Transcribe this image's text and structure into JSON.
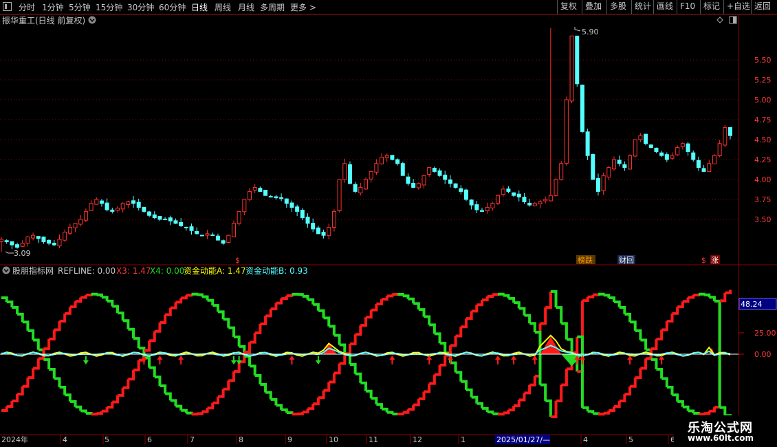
{
  "toolbar": {
    "periods": [
      "分时",
      "1分钟",
      "5分钟",
      "15分钟",
      "30分钟",
      "60分钟",
      "日线",
      "周线",
      "月线",
      "多周期",
      "更多 >"
    ],
    "active_period": "日线",
    "actions": [
      "复权",
      "叠加",
      "多股",
      "统计",
      "画线",
      "F10",
      "标记",
      "+自选",
      "返回"
    ]
  },
  "price_panel": {
    "title": "振华重工(日线 前复权)",
    "high_label": "5.90",
    "low_label": "3.09",
    "y_ticks": [
      "5.50",
      "5.25",
      "5.00",
      "4.75",
      "4.50",
      "4.25",
      "4.00",
      "3.75",
      "3.50"
    ],
    "markers": [
      {
        "text": "$",
        "color": "#ff3333"
      },
      {
        "text": "榜跌",
        "color": "#ff8800"
      },
      {
        "text": "财回",
        "color": "#ffffff"
      },
      {
        "text": "$",
        "color": "#ff3333"
      },
      {
        "text": "涨",
        "color": "#ffffff"
      }
    ]
  },
  "indicator_panel": {
    "name": "股朋指标网",
    "refline_label": "REFLINE: 0.00",
    "x3_label": "X3: 1.47",
    "x4_label": "X4: 0.00",
    "zjA_label": "资金动能A: 1.47",
    "zjB_label": "资金动能B: 0.93",
    "y_ticks": [
      "48.24",
      "25.00",
      "0.00"
    ],
    "highlight_value": "48.24"
  },
  "x_axis": {
    "labels": [
      "2024年",
      "4",
      "5",
      "6",
      "7",
      "8",
      "9",
      "10",
      "11",
      "12",
      "1",
      "2025/01/27/—",
      "4",
      "5",
      "6"
    ]
  },
  "watermark": {
    "title": "乐淘公式网",
    "url": "www.60lt.com"
  },
  "colors": {
    "up": "#ff3232",
    "down": "#54ffff",
    "green": "#22dd22",
    "red": "#ff1a1a",
    "yellow": "#ffff00",
    "grid": "#8b0000",
    "axis": "#c80000"
  },
  "chart_data": {
    "type": "candlestick",
    "price_range": [
      3.09,
      5.9
    ],
    "closes": [
      3.25,
      3.22,
      3.18,
      3.15,
      3.2,
      3.28,
      3.3,
      3.26,
      3.22,
      3.2,
      3.18,
      3.25,
      3.34,
      3.4,
      3.45,
      3.5,
      3.6,
      3.7,
      3.75,
      3.7,
      3.62,
      3.6,
      3.64,
      3.7,
      3.72,
      3.7,
      3.65,
      3.6,
      3.55,
      3.52,
      3.5,
      3.5,
      3.48,
      3.45,
      3.42,
      3.4,
      3.36,
      3.32,
      3.3,
      3.32,
      3.3,
      3.24,
      3.2,
      3.3,
      3.45,
      3.6,
      3.75,
      3.85,
      3.9,
      3.85,
      3.8,
      3.78,
      3.77,
      3.76,
      3.7,
      3.65,
      3.6,
      3.52,
      3.45,
      3.38,
      3.32,
      3.3,
      3.4,
      3.6,
      4.0,
      4.2,
      3.95,
      3.85,
      3.9,
      4.0,
      4.1,
      4.2,
      4.28,
      4.3,
      4.25,
      4.2,
      4.05,
      3.95,
      3.9,
      3.95,
      4.05,
      4.15,
      4.1,
      4.05,
      4.0,
      3.95,
      3.9,
      3.85,
      3.75,
      3.68,
      3.62,
      3.6,
      3.65,
      3.7,
      3.8,
      3.88,
      3.85,
      3.8,
      3.78,
      3.72,
      3.68,
      3.7,
      3.72,
      3.75,
      3.8,
      4.0,
      4.2,
      5.0,
      5.8,
      5.2,
      4.6,
      4.3,
      4.0,
      3.85,
      4.05,
      4.15,
      4.25,
      4.2,
      4.15,
      4.3,
      4.5,
      4.55,
      4.45,
      4.4,
      4.35,
      4.3,
      4.25,
      4.3,
      4.4,
      4.45,
      4.35,
      4.25,
      4.15,
      4.1,
      4.2,
      4.3,
      4.45,
      4.65,
      4.55
    ],
    "indicator_range": [
      -55,
      55
    ],
    "x3_last": 1.47,
    "x4_last": 0.0,
    "zjA_last": 1.47,
    "zjB_last": 0.93,
    "upper_line_last": 48.24
  }
}
